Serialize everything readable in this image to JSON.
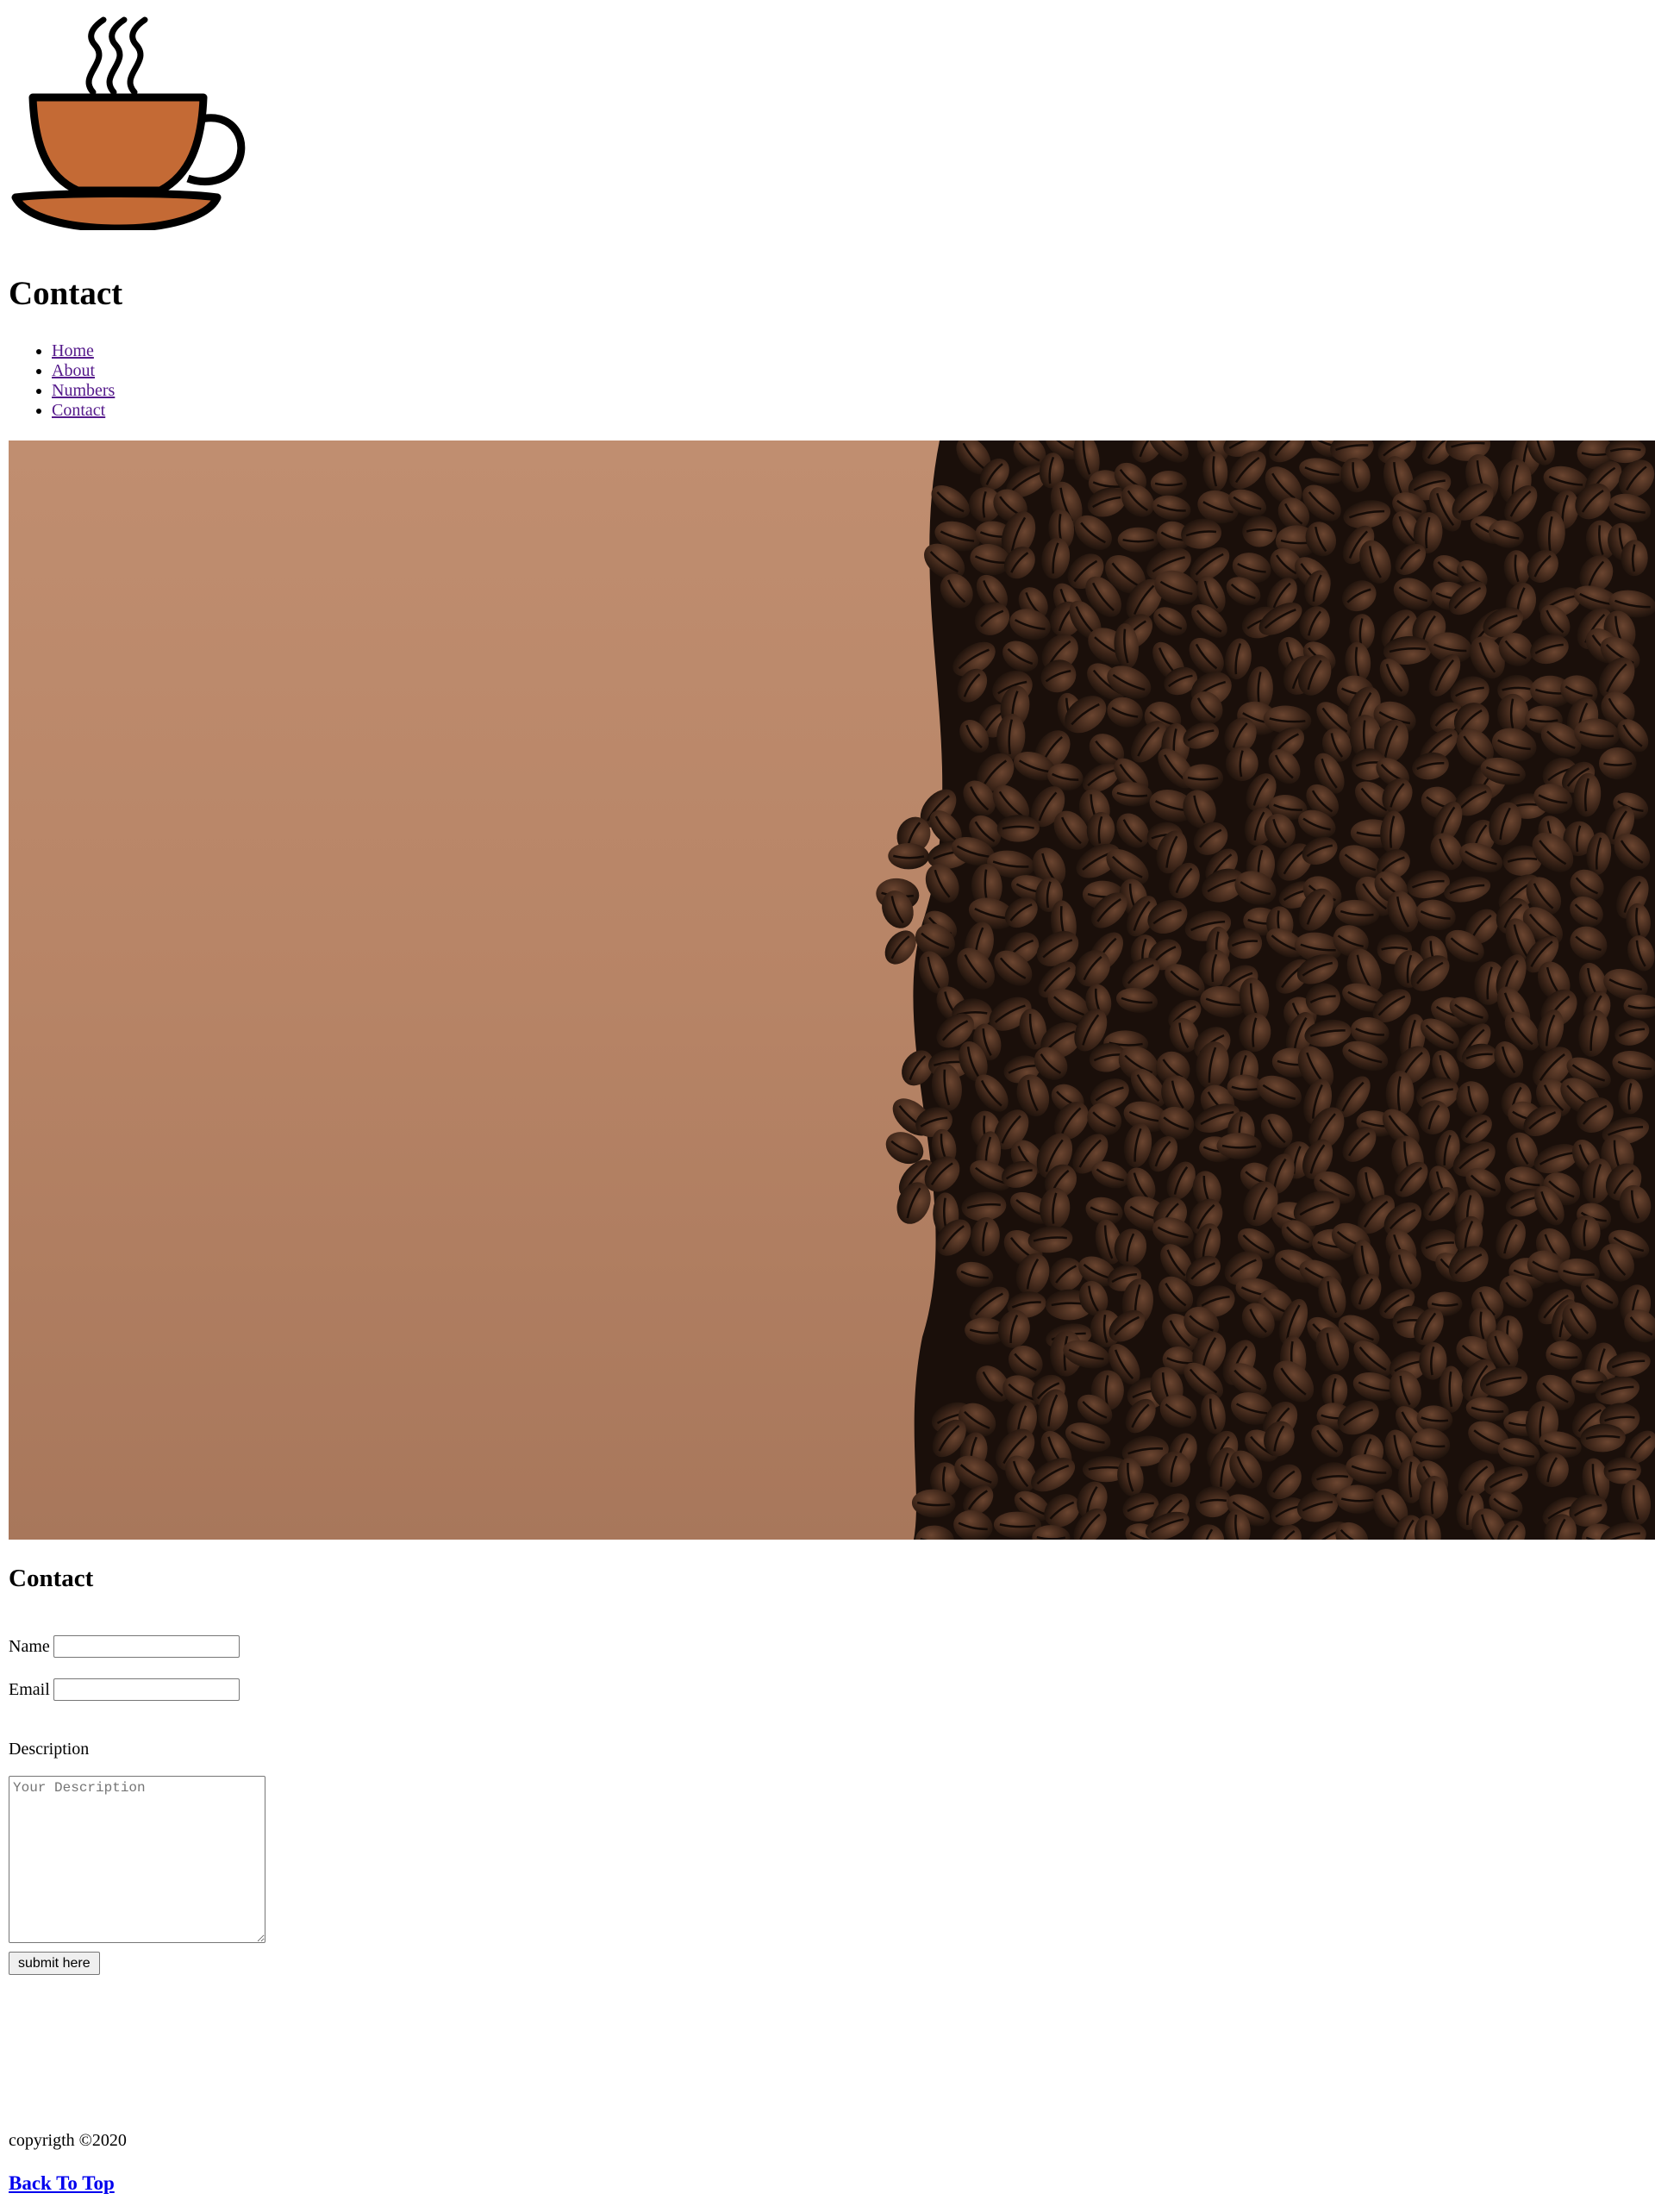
{
  "page": {
    "title": "Contact"
  },
  "logo": {
    "icon": "coffee-cup-icon",
    "colors": {
      "cup_fill": "#c46a35",
      "outline": "#000000"
    }
  },
  "nav": {
    "items": [
      {
        "label": "Home"
      },
      {
        "label": "About"
      },
      {
        "label": "Numbers"
      },
      {
        "label": "Contact"
      }
    ],
    "link_color": "#551a8b"
  },
  "hero": {
    "subject": "coffee-beans-on-brown-paper",
    "colors": {
      "paper": "#b98668",
      "bean_dark": "#2a1a12",
      "bean_mid": "#4a2f20"
    }
  },
  "contact": {
    "heading": "Contact",
    "name_label": "Name",
    "name_value": "",
    "email_label": "Email",
    "email_value": "",
    "description_label": "Description",
    "description_placeholder": "Your Description",
    "submit_label": "submit here"
  },
  "footer": {
    "copyright": "copyrigth ©2020",
    "back_to_top": "Back To Top"
  }
}
